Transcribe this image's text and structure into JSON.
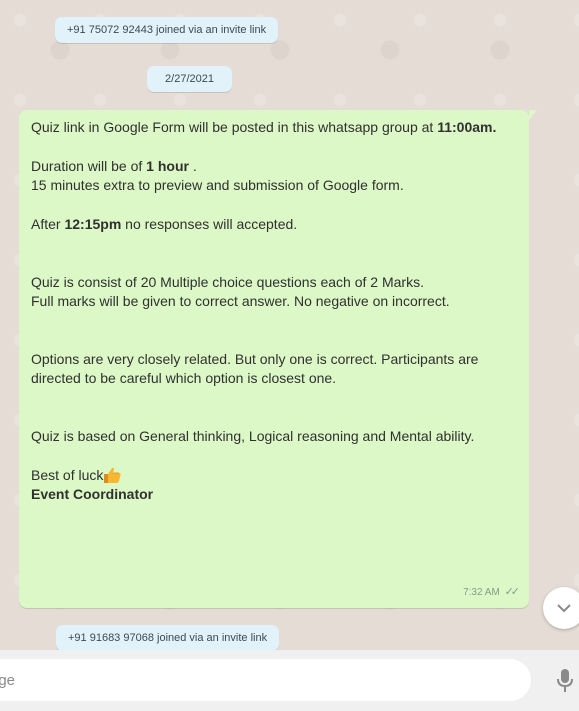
{
  "system_messages": {
    "top": "+91 75072 92443 joined via an invite link",
    "date": "2/27/2021",
    "bottom": "+91 91683 97068 joined via an invite link"
  },
  "message": {
    "line1": "Quiz link in Google Form will be posted in this whatsapp group at ",
    "time_bold": "11:00am.",
    "duration_prefix": "Duration will be of ",
    "duration_bold": "1 hour",
    "duration_suffix": " .",
    "extra_line": "15 minutes extra to preview and submission of Google form.",
    "after_prefix": "After ",
    "after_bold": "12:15pm",
    "after_suffix": " no responses will accepted.",
    "quiz_info_1": "Quiz is consist of 20 Multiple choice questions each of 2 Marks.",
    "quiz_info_2": "Full marks will be given to correct answer. No negative on incorrect.",
    "options_info": "Options are very closely related. But only one is correct. Participants are directed to be careful which option is closest one.",
    "basis_info": "Quiz  is based on General thinking, Logical reasoning and Mental ability.",
    "wish": "Best of luck",
    "signature": "Event Coordinator",
    "timestamp": "7:32 AM",
    "status_icon": "double-check-icon"
  },
  "composer": {
    "placeholder": "age"
  },
  "icons": {
    "scroll": "chevron-down-icon",
    "mic": "mic-icon",
    "emoji": "thumbs-up-emoji"
  },
  "colors": {
    "bubble": "#dcf8c6",
    "system_pill": "#e1f2fb",
    "chat_bg": "#e5ddd5"
  }
}
